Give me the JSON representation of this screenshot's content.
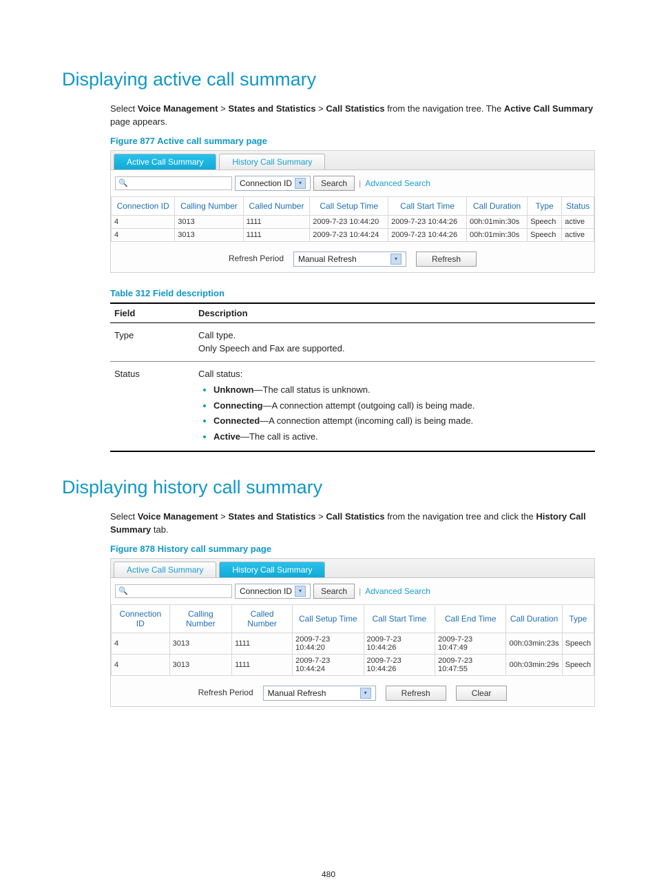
{
  "page_number": "480",
  "section1": {
    "heading": "Displaying active call summary",
    "intro_prefix": "Select ",
    "bc1": "Voice Management",
    "bc2": "States and Statistics",
    "bc3": "Call Statistics",
    "intro_mid": " from the navigation tree. The ",
    "bc4": "Active Call Summary",
    "intro_suffix": " page appears.",
    "figure_caption": "Figure 877 Active call summary page"
  },
  "ui1": {
    "tab_active": "Active Call Summary",
    "tab_inactive": "History Call Summary",
    "select_value": "Connection ID",
    "search_btn": "Search",
    "adv_link": "Advanced Search",
    "cols": [
      "Connection ID",
      "Calling Number",
      "Called Number",
      "Call Setup Time",
      "Call Start Time",
      "Call Duration",
      "Type",
      "Status"
    ],
    "rows": [
      [
        "4",
        "3013",
        "1111",
        "2009-7-23 10:44:20",
        "2009-7-23 10:44:26",
        "00h:01min:30s",
        "Speech",
        "active"
      ],
      [
        "4",
        "3013",
        "1111",
        "2009-7-23 10:44:24",
        "2009-7-23 10:44:26",
        "00h:01min:30s",
        "Speech",
        "active"
      ]
    ],
    "refresh_label": "Refresh Period",
    "refresh_select": "Manual Refresh",
    "refresh_btn": "Refresh"
  },
  "table312": {
    "caption": "Table 312 Field description",
    "h1": "Field",
    "h2": "Description",
    "row1_field": "Type",
    "row1_line1": "Call type.",
    "row1_line2": "Only Speech and Fax are supported.",
    "row2_field": "Status",
    "row2_intro": "Call status:",
    "row2_items": [
      {
        "b": "Unknown",
        "rest": "—The call status is unknown."
      },
      {
        "b": "Connecting",
        "rest": "—A connection attempt (outgoing call) is being made."
      },
      {
        "b": "Connected",
        "rest": "—A connection attempt (incoming call) is being made."
      },
      {
        "b": "Active",
        "rest": "—The call is active."
      }
    ]
  },
  "section2": {
    "heading": "Displaying history call summary",
    "intro_prefix": "Select ",
    "bc1": "Voice Management",
    "bc2": "States and Statistics",
    "bc3": "Call Statistics",
    "intro_mid": " from the navigation tree and click the ",
    "bc4": "History Call Summary",
    "intro_suffix": " tab.",
    "figure_caption": "Figure 878 History call summary page"
  },
  "ui2": {
    "tab_inactive": "Active Call Summary",
    "tab_active": "History Call Summary",
    "select_value": "Connection ID",
    "search_btn": "Search",
    "adv_link": "Advanced Search",
    "cols": [
      "Connection ID",
      "Calling Number",
      "Called Number",
      "Call Setup Time",
      "Call Start Time",
      "Call End Time",
      "Call Duration",
      "Type"
    ],
    "rows": [
      [
        "4",
        "3013",
        "1111",
        "2009-7-23 10:44:20",
        "2009-7-23 10:44:26",
        "2009-7-23 10:47:49",
        "00h:03min:23s",
        "Speech"
      ],
      [
        "4",
        "3013",
        "1111",
        "2009-7-23 10:44:24",
        "2009-7-23 10:44:26",
        "2009-7-23 10:47:55",
        "00h:03min:29s",
        "Speech"
      ]
    ],
    "refresh_label": "Refresh Period",
    "refresh_select": "Manual Refresh",
    "refresh_btn": "Refresh",
    "clear_btn": "Clear"
  }
}
